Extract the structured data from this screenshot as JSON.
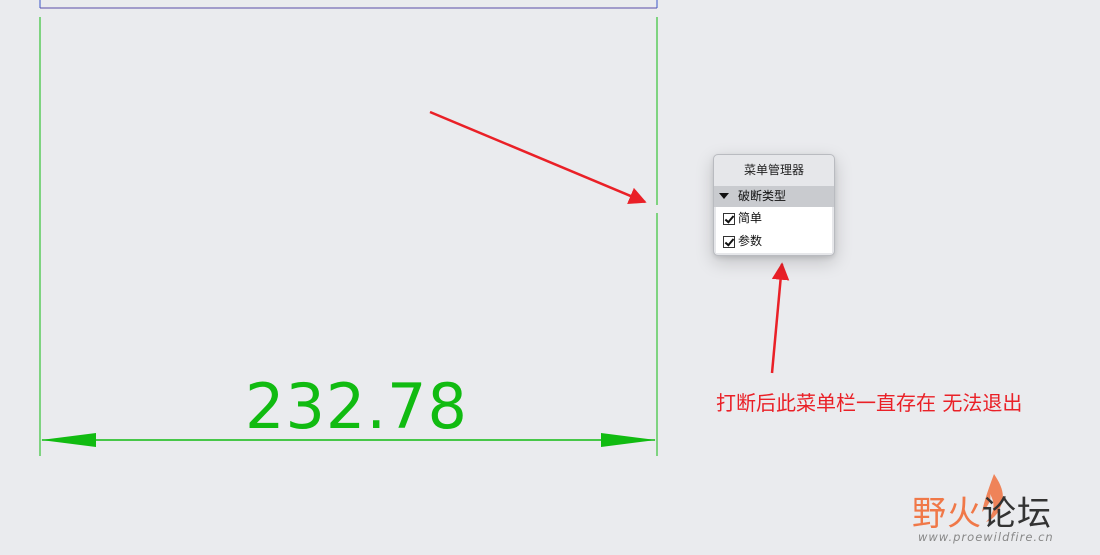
{
  "drawing": {
    "dimension_value": "232.78",
    "colors": {
      "dimension": "#11bb11",
      "annotation": "#ea2027",
      "background": "#eaebee",
      "frame": "#6a5acd"
    }
  },
  "menu_manager": {
    "title": "菜单管理器",
    "section": {
      "label": "破断类型",
      "icon": "triangle-down-icon"
    },
    "items": [
      {
        "label": "简单",
        "checked": true
      },
      {
        "label": "参数",
        "checked": true
      }
    ]
  },
  "annotation": {
    "text": "打断后此菜单栏一直存在 无法退出"
  },
  "watermark": {
    "name_part1": "野火",
    "name_part2": "论坛",
    "url": "www.proewildfire.cn"
  }
}
